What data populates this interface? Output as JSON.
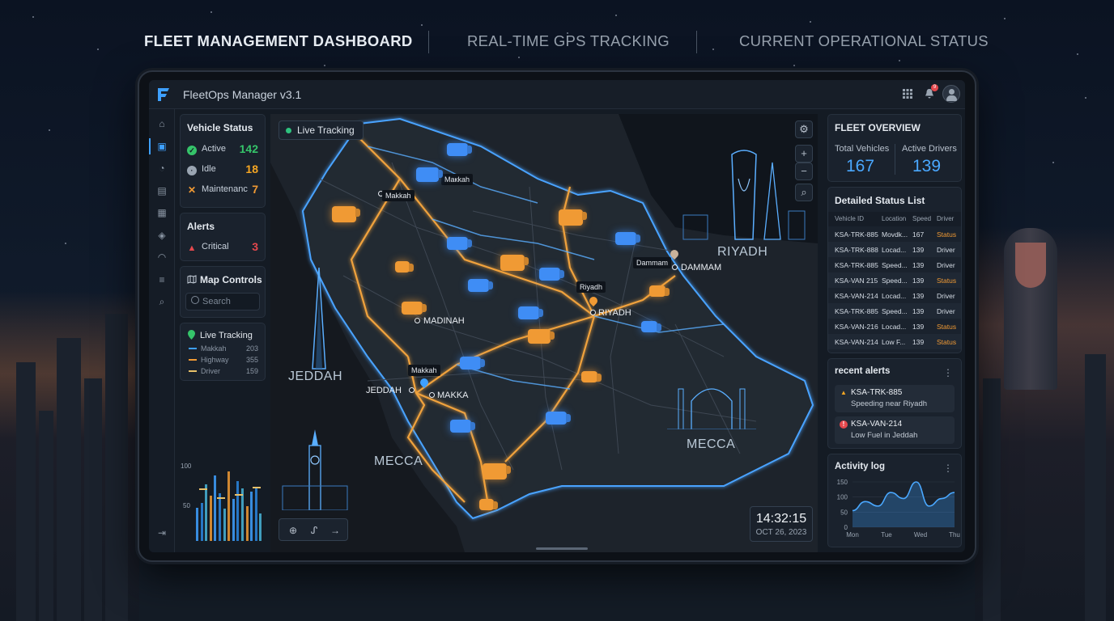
{
  "header_tabs": [
    "FLEET MANAGEMENT DASHBOARD",
    "REAL-TIME GPS TRACKING",
    "CURRENT OPERATIONAL STATUS"
  ],
  "app": {
    "title": "FleetOps Manager v3.1",
    "notification_count": "9"
  },
  "vehicle_status": {
    "title": "Vehicle Status",
    "items": [
      {
        "label": "Active",
        "value": "142",
        "color": "#35c46a"
      },
      {
        "label": "Idle",
        "value": "18",
        "color": "#f5a623"
      },
      {
        "label": "Maintenanc",
        "value": "7",
        "color": "#f09a34"
      }
    ]
  },
  "alerts_panel": {
    "title": "Alerts",
    "critical_label": "Critical",
    "critical_value": "3"
  },
  "map_controls": {
    "title": "Map Controls",
    "search_placeholder": "Search"
  },
  "live_tracking_legend": {
    "title": "Live Tracking",
    "items": [
      {
        "label": "Makkah",
        "value": "203",
        "color": "#3ea0ff"
      },
      {
        "label": "Highway",
        "value": "355",
        "color": "#f09a34"
      },
      {
        "label": "Driver",
        "value": "159",
        "color": "#e8c16a"
      }
    ]
  },
  "mini_chart": {
    "y_ticks": [
      "100",
      "50"
    ],
    "bars": [
      0.46,
      0.52,
      0.78,
      0.62,
      0.9,
      0.66,
      0.44,
      0.96,
      0.58,
      0.82,
      0.72,
      0.48,
      0.68,
      0.74,
      0.38
    ],
    "markers": [
      0.72,
      0.6,
      0.64,
      0.74
    ]
  },
  "map": {
    "live_pill": "Live Tracking",
    "city_labels": [
      "RIYADH",
      "DAMMAM",
      "MADINAH",
      "JEDDAH",
      "MAKKA"
    ],
    "city_tags": [
      "Makkah",
      "Mакkah",
      "Riyadh",
      "Dammam",
      "Makkah"
    ],
    "big_labels": [
      "RIYADH",
      "JEDDAH",
      "MECCA",
      "MECCA"
    ],
    "clock_time": "14:32:15",
    "clock_date": "OCT 26, 2023"
  },
  "fleet_overview": {
    "title": "FLEET OVERVIEW",
    "total_label": "Total Vehicles",
    "total_value": "167",
    "drivers_label": "Active Drivers",
    "drivers_value": "139"
  },
  "status_list": {
    "title": "Detailed Status List",
    "columns": [
      "Vehicle ID",
      "Location",
      "Speed",
      "Driver"
    ],
    "rows": [
      [
        "KSA-TRK-885",
        "Movdk...",
        "167",
        "Status"
      ],
      [
        "KSA-TRK-888",
        "Locad...",
        "139",
        "Driver"
      ],
      [
        "KSA-TRK-885",
        "Speed...",
        "139",
        "Driver"
      ],
      [
        "KSA-VAN 215",
        "Speed...",
        "139",
        "Status"
      ],
      [
        "KSA-VAN-214",
        "Locad...",
        "139",
        "Driver"
      ],
      [
        "KSA-TRK-885",
        "Speed...",
        "139",
        "Driver"
      ],
      [
        "KSA-VAN-216",
        "Locad...",
        "139",
        "Status"
      ],
      [
        "KSA-VAN-214",
        "Low F...",
        "139",
        "Status"
      ]
    ]
  },
  "recent_alerts": {
    "title": "recent alerts",
    "items": [
      {
        "id": "KSA-TRK-885",
        "message": "Speeding near Riyadh",
        "severity_color": "#f5a623"
      },
      {
        "id": "KSA-VAN-214",
        "message": "Low Fuel in Jeddah",
        "severity_color": "#e5484d"
      }
    ]
  },
  "activity_log": {
    "title": "Activity log",
    "chart_data": {
      "type": "area",
      "x": [
        "Mon",
        "Tue",
        "Wed",
        "Thu"
      ],
      "y_ticks": [
        "150",
        "100",
        "50",
        "0"
      ],
      "ylim": [
        0,
        150
      ],
      "series": [
        {
          "values": [
            55,
            85,
            70,
            115,
            95,
            150,
            70,
            95,
            115
          ]
        }
      ]
    }
  },
  "colors": {
    "accent": "#3ea0ff",
    "warning": "#f09a34",
    "success": "#35c46a",
    "danger": "#e5484d"
  }
}
